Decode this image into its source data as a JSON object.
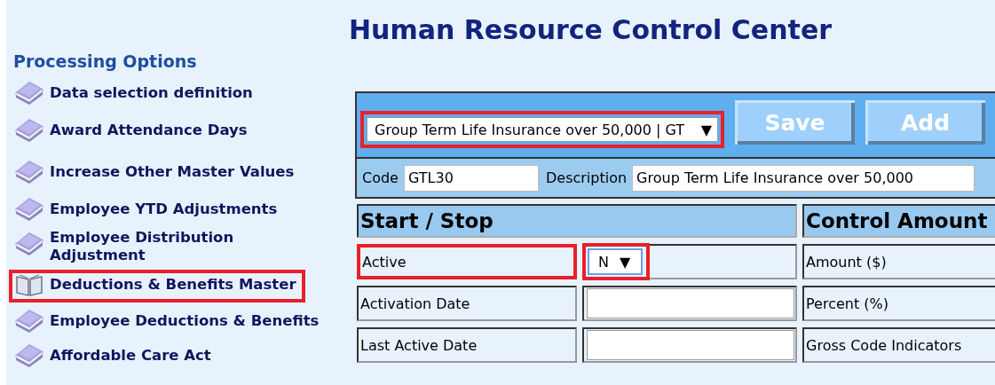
{
  "title": "Human Resource Control Center",
  "sidebar": {
    "heading": "Processing Options",
    "items": [
      {
        "label": "Data selection definition",
        "selected": false,
        "highlighted": false
      },
      {
        "label": "Award Attendance Days",
        "selected": false,
        "highlighted": false
      },
      {
        "label": "Increase Other Master Values",
        "selected": false,
        "highlighted": false
      },
      {
        "label": "Employee YTD Adjustments",
        "selected": false,
        "highlighted": false
      },
      {
        "label": "Employee Distribution Adjustment",
        "selected": false,
        "highlighted": false
      },
      {
        "label": "Deductions & Benefits Master",
        "selected": true,
        "highlighted": true
      },
      {
        "label": "Employee Deductions & Benefits",
        "selected": false,
        "highlighted": false
      },
      {
        "label": "Affordable Care Act",
        "selected": false,
        "highlighted": false
      }
    ]
  },
  "form": {
    "record_select": {
      "value": "Group Term Life Insurance over 50,000 | GT",
      "arrow": "▼",
      "highlighted": true
    },
    "buttons": [
      "Save",
      "Add"
    ],
    "code": {
      "label": "Code",
      "value": "GTL30"
    },
    "description": {
      "label": "Description",
      "value": "Group Term Life Insurance over 50,000"
    },
    "start_stop": {
      "heading": "Start / Stop",
      "rows": [
        {
          "label": "Active",
          "kind": "select",
          "value": "N",
          "arrow": "▼",
          "highlighted": true
        },
        {
          "label": "Activation Date",
          "kind": "input",
          "highlighted": false
        },
        {
          "label": "Last Active Date",
          "kind": "input",
          "highlighted": false
        }
      ]
    },
    "control_amount": {
      "heading": "Control Amount",
      "rows": [
        {
          "label": "Amount ($)"
        },
        {
          "label": "Percent (%)"
        },
        {
          "label": "Gross Code Indicators"
        }
      ]
    }
  }
}
